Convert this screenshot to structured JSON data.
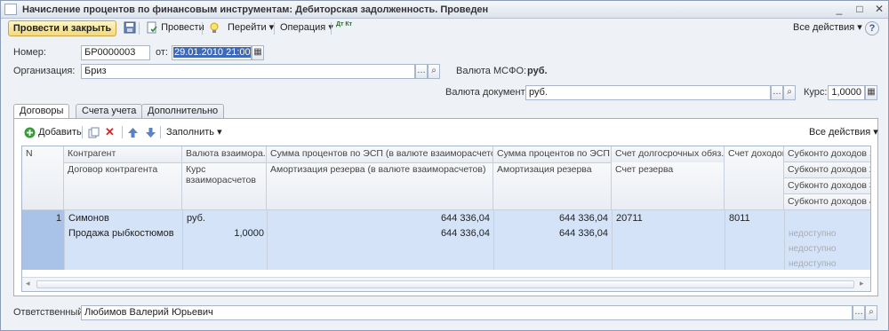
{
  "window": {
    "title": "Начисление процентов по финансовым инструментам: Дебиторская задолженность. Проведен",
    "btn_minimize": "_",
    "btn_maximize": "□",
    "btn_close": "✕"
  },
  "toolbar": {
    "post_close": "Провести и закрыть",
    "post": "Провести",
    "goto": "Перейти",
    "operation": "Операция",
    "dtkt": "Дт Кт",
    "all_actions": "Все действия",
    "help": "?"
  },
  "header": {
    "number_label": "Номер:",
    "number_value": "БР0000003",
    "from_label": "от:",
    "date_value": "29.01.2010 21:00:00",
    "org_label": "Организация:",
    "org_value": "Бриз",
    "msfo_currency_label": "Валюта МСФО:",
    "msfo_currency_value": "руб.",
    "doc_currency_label": "Валюта документа:",
    "doc_currency_value": "руб.",
    "rate_label": "Курс:",
    "rate_value": "1,0000"
  },
  "tabs": [
    {
      "label": "Договоры"
    },
    {
      "label": "Счета учета"
    },
    {
      "label": "Дополнительно"
    }
  ],
  "grid_toolbar": {
    "add": "Добавить",
    "fill": "Заполнить",
    "all_actions": "Все действия"
  },
  "columns": {
    "n": "N",
    "contractor": "Контрагент",
    "contract": "Договор контрагента",
    "currency": "Валюта взаимора...",
    "rate": "Курс взаиморасчетов",
    "interest_sum": "Сумма процентов по ЭСП (в валюте взаиморасчетов)",
    "amortization": "Амортизация резерва (в валюте взаиморасчетов)",
    "interest_esp": "Сумма процентов по ЭСП",
    "amort_reserve": "Амортизация резерва",
    "long_account": "Счет долгосрочных обяз...",
    "reserve_account": "Счет резерва",
    "income_account": "Счет доходов",
    "sub1": "Субконто доходов 1",
    "sub2": "Субконто доходов 2",
    "sub3": "Субконто доходов 3",
    "sub4": "Субконто доходов 4"
  },
  "rows": [
    {
      "n": "1",
      "contractor": "Симонов",
      "contract": "Продажа рыбкостюмов",
      "currency": "руб.",
      "rate": "1,0000",
      "interest_sum": "644 336,04",
      "amortization": "644 336,04",
      "interest_esp": "644 336,04",
      "amort_reserve": "644 336,04",
      "long_account": "20711",
      "income_account": "8011",
      "sub2": "недоступно",
      "sub3": "недоступно",
      "sub4": "недоступно"
    }
  ],
  "footer": {
    "responsible_label": "Ответственный:",
    "responsible_value": "Любимов Валерий Юрьевич"
  }
}
